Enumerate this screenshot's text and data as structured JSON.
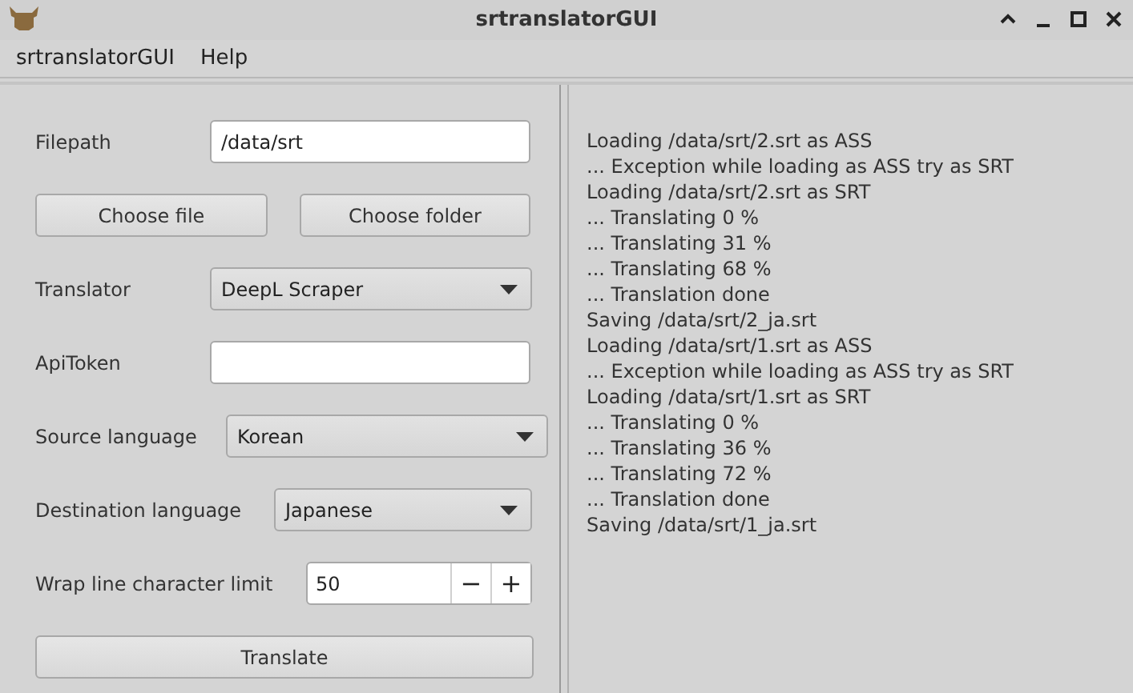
{
  "window": {
    "title": "srtranslatorGUI"
  },
  "menu": [
    {
      "label": "srtranslatorGUI"
    },
    {
      "label": "Help"
    }
  ],
  "form": [
    {
      "kind": "text",
      "label": "Filepath",
      "value": "/data/srt"
    },
    {
      "kind": "buttons",
      "buttons": [
        "Choose file",
        "Choose folder"
      ]
    },
    {
      "kind": "combo",
      "label": "Translator",
      "value": "DeepL Scraper"
    },
    {
      "kind": "text",
      "label": "ApiToken"
    },
    {
      "kind": "combo",
      "label": "Source language",
      "value": "Korean"
    },
    {
      "kind": "combo",
      "label": "Destination language",
      "value": "Japanese"
    },
    {
      "kind": "spin",
      "label": "Wrap line character limit",
      "value": "50",
      "minus": "−",
      "plus": "+"
    },
    {
      "kind": "button",
      "label": "Translate"
    }
  ],
  "log": [
    "Loading /data/srt/2.srt as ASS",
    "... Exception while loading as ASS try as SRT",
    "Loading /data/srt/2.srt as SRT",
    "... Translating 0 %",
    "... Translating 31 %",
    "... Translating 68 %",
    "... Translation done",
    "Saving /data/srt/2_ja.srt",
    "Loading /data/srt/1.srt as ASS",
    "... Exception while loading as ASS try as SRT",
    "Loading /data/srt/1.srt as SRT",
    "... Translating 0 %",
    "... Translating 36 %",
    "... Translating 72 %",
    "... Translation done",
    "Saving /data/srt/1_ja.srt"
  ]
}
